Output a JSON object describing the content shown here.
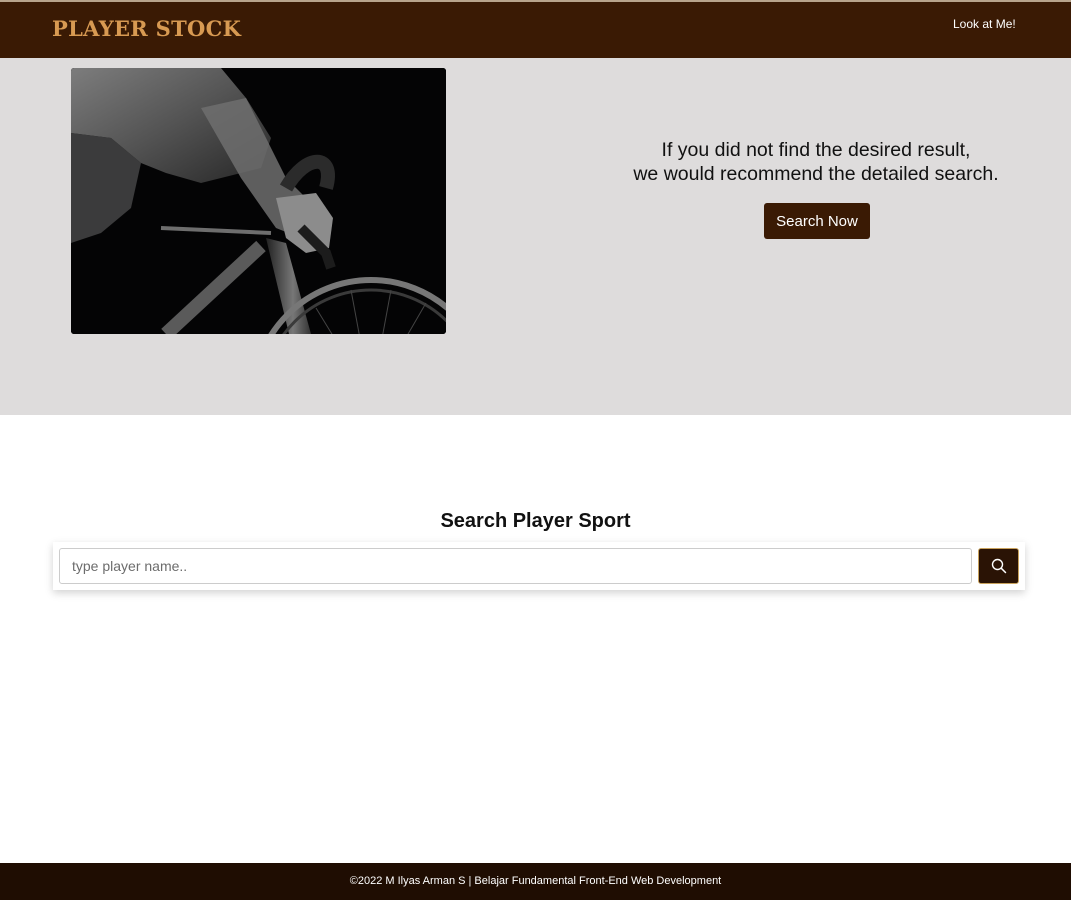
{
  "header": {
    "brand": "PLAYER STOCK",
    "nav_link": "Look at Me!"
  },
  "hero": {
    "line1": "If you did not find the desired result,",
    "line2": "we would recommend the detailed search.",
    "button_label": "Search Now",
    "image": "cyclist-on-bike-photo"
  },
  "search": {
    "title": "Search Player Sport",
    "placeholder": "type player name..",
    "button_icon": "search-icon"
  },
  "footer": {
    "text": "©2022 M Ilyas Arman S | Belajar Fundamental Front-End Web Development"
  },
  "colors": {
    "header_bg": "#3a1a04",
    "brand": "#d89a52",
    "hero_bg": "#dedcdc",
    "button_bg": "#3a1a04",
    "footer_bg": "#1f0d02"
  }
}
